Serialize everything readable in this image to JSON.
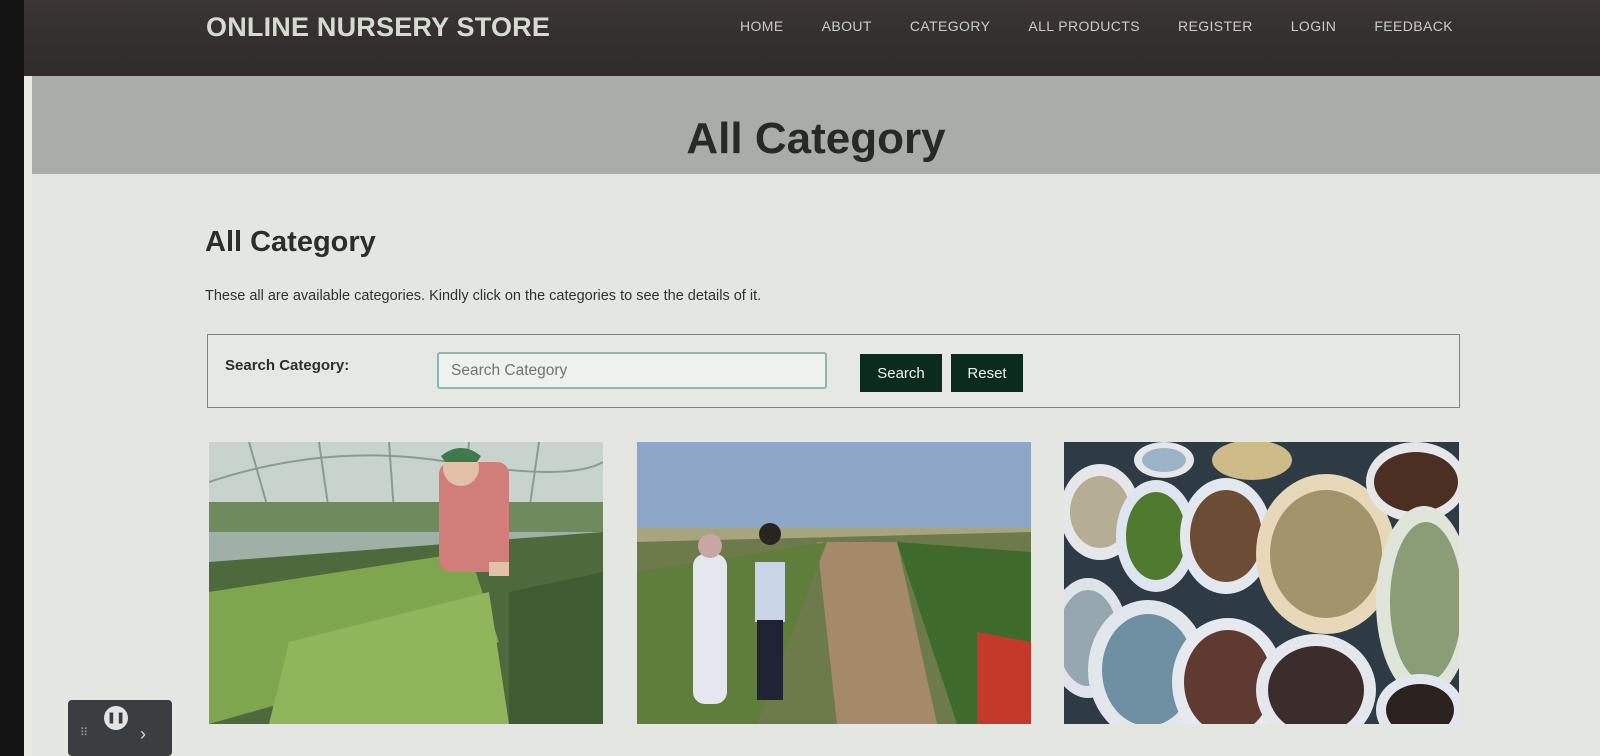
{
  "brand": "ONLINE NURSERY STORE",
  "nav": [
    "HOME",
    "ABOUT",
    "CATEGORY",
    "ALL PRODUCTS",
    "REGISTER",
    "LOGIN",
    "FEEDBACK"
  ],
  "hero": {
    "title": "All Category"
  },
  "section": {
    "title": "All Category",
    "description": "These all are available categories. Kindly click on the categories to see the details of it."
  },
  "search": {
    "label": "Search Category:",
    "placeholder": "Search Category",
    "value": "",
    "search_button": "Search",
    "reset_button": "Reset"
  },
  "categories": [
    {
      "image": "greenhouse-seedlings-photo"
    },
    {
      "image": "farm-field-workers-photo"
    },
    {
      "image": "seed-sacks-photo"
    }
  ],
  "colors": {
    "navbar": "#332f2e",
    "brand_text": "#d5dccf",
    "hero_band": "#a9ada7",
    "button": "#0b2b1f"
  }
}
